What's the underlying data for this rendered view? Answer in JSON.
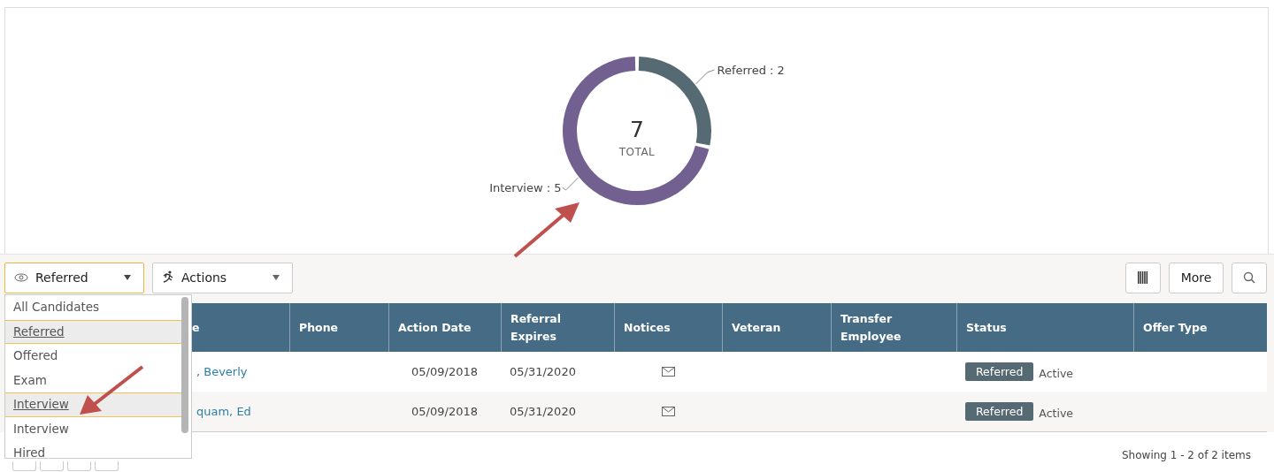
{
  "chart_panel": {
    "chart_data": {
      "type": "donut",
      "categories": [
        "Referred : 2",
        "Interview : 5"
      ],
      "values": [
        2,
        5
      ],
      "colors": [
        "#566a74",
        "#726190"
      ]
    },
    "center_value": "7",
    "center_label": "TOTAL"
  },
  "toolbar": {
    "view_dropdown": {
      "value": "Referred",
      "expanded": true
    },
    "actions_dropdown": {
      "value": "Actions"
    },
    "more_button": "More"
  },
  "view_menu": {
    "items": [
      {
        "label": "All Candidates",
        "highlighted": false
      },
      {
        "label": "Referred",
        "highlighted": true
      },
      {
        "label": "Offered",
        "highlighted": false
      },
      {
        "label": "Exam",
        "highlighted": false
      },
      {
        "label": "Interview",
        "highlighted": true
      },
      {
        "label": "Interview",
        "highlighted": false
      },
      {
        "label": "Hired",
        "highlighted": false
      }
    ]
  },
  "table": {
    "columns": [
      "e",
      "Phone",
      "Action Date",
      "Referral Expires",
      "Notices",
      "Veteran",
      "Transfer Employee",
      "Status",
      "Offer Type"
    ],
    "rows": [
      {
        "name": ", Beverly",
        "action_date": "05/09/2018",
        "referral_expires": "05/31/2020",
        "notice": true,
        "status": "Referred",
        "state": "Active"
      },
      {
        "name": "quam, Ed",
        "action_date": "05/09/2018",
        "referral_expires": "05/31/2020",
        "notice": true,
        "status": "Referred",
        "state": "Active"
      }
    ]
  },
  "footer": {
    "summary": "Showing 1 - 2 of 2 items"
  }
}
